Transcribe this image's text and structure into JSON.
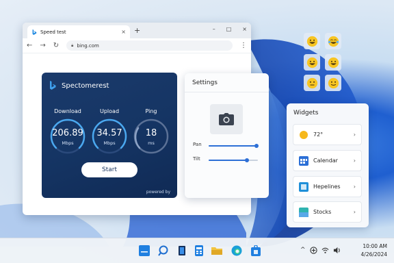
{
  "browser": {
    "tab_title": "Speed test",
    "tab_close": "×",
    "new_tab": "+",
    "window_controls": {
      "minimize": "–",
      "maximize": "□",
      "close": "×"
    },
    "nav": {
      "back": "←",
      "forward": "→",
      "reload": "↻",
      "menu": "⋮"
    },
    "url": "bing.com"
  },
  "speedtest": {
    "brand": "Spectomerest",
    "download": {
      "label": "Download",
      "value": "206.89",
      "unit": "Mbps"
    },
    "upload": {
      "label": "Upload",
      "value": "34.57",
      "unit": "Mbps"
    },
    "ping": {
      "label": "Ping",
      "value": "18",
      "unit": "ms"
    },
    "start_label": "Start",
    "powered": "powered by",
    "accent_color": "#4aa8ef"
  },
  "settings": {
    "title": "Settings",
    "pan": {
      "label": "Pan",
      "level": 0.97
    },
    "tilt": {
      "label": "Tilt",
      "level": 0.78
    },
    "camera_icon": "camera-icon"
  },
  "emoji_tiles": [
    "grinning",
    "tears-of-joy",
    "grinning",
    "grinning",
    "neutral",
    "slight-smile"
  ],
  "widgets": {
    "title": "Widgets",
    "items": [
      {
        "label": "72°",
        "icon": "sun-icon"
      },
      {
        "label": "Calendar",
        "icon": "calendar-icon"
      },
      {
        "label": "Hepelines",
        "icon": "headlines-icon"
      },
      {
        "label": "Stocks",
        "icon": "stocks-icon"
      }
    ],
    "chevron": "›"
  },
  "taskbar": {
    "time": "10:00 AM",
    "date": "4/26/2024",
    "tray_chevron": "^"
  }
}
